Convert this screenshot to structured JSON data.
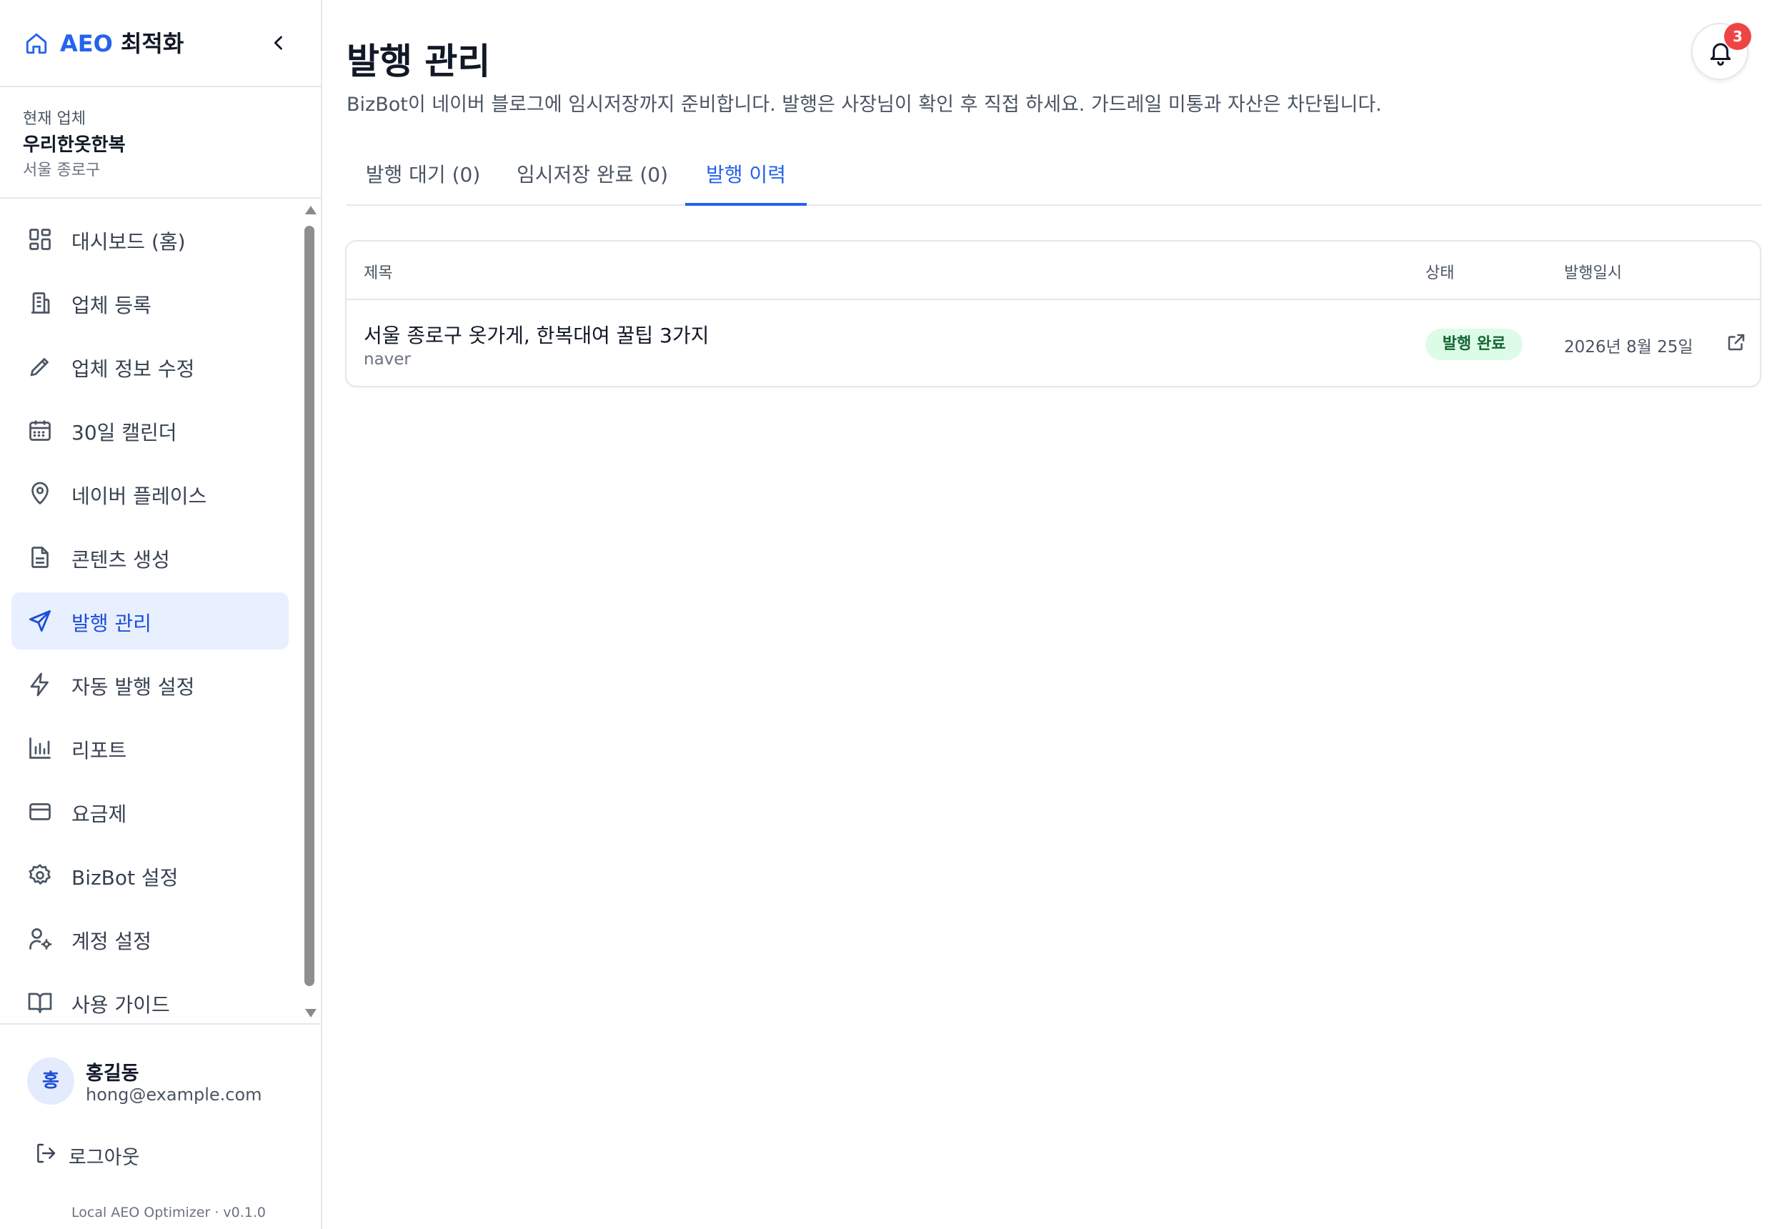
{
  "brand": {
    "accent": "AEO",
    "title": " 최적화"
  },
  "business": {
    "label": "현재 업체",
    "name": "우리한옷한복",
    "location": "서울 종로구"
  },
  "nav": {
    "items": [
      {
        "label": "대시보드 (홈)",
        "icon": "dashboard-icon"
      },
      {
        "label": "업체 등록",
        "icon": "building-icon"
      },
      {
        "label": "업체 정보 수정",
        "icon": "pencil-icon"
      },
      {
        "label": "30일 캘린더",
        "icon": "calendar-icon"
      },
      {
        "label": "네이버 플레이스",
        "icon": "map-pin-icon"
      },
      {
        "label": "콘텐츠 생성",
        "icon": "document-icon"
      },
      {
        "label": "발행 관리",
        "icon": "send-icon",
        "active": true
      },
      {
        "label": "자동 발행 설정",
        "icon": "lightning-icon"
      },
      {
        "label": "리포트",
        "icon": "bar-chart-icon"
      },
      {
        "label": "요금제",
        "icon": "credit-card-icon"
      },
      {
        "label": "BizBot 설정",
        "icon": "gear-icon"
      },
      {
        "label": "계정 설정",
        "icon": "user-cog-icon"
      },
      {
        "label": "사용 가이드",
        "icon": "book-icon"
      }
    ]
  },
  "user": {
    "initial": "홍",
    "name": "홍길동",
    "email": "hong@example.com"
  },
  "logout": {
    "label": "로그아웃"
  },
  "version": "Local AEO Optimizer · v0.1.0",
  "page": {
    "title": "발행 관리",
    "description": "BizBot이 네이버 블로그에 임시저장까지 준비합니다. 발행은 사장님이 확인 후 직접 하세요. 가드레일 미통과 자산은 차단됩니다."
  },
  "notifications": {
    "count": "3"
  },
  "tabs": [
    {
      "label": "발행 대기 (0)"
    },
    {
      "label": "임시저장 완료 (0)"
    },
    {
      "label": "발행 이력",
      "active": true
    }
  ],
  "table": {
    "headers": {
      "title": "제목",
      "status": "상태",
      "date": "발행일시"
    },
    "rows": [
      {
        "title": "서울 종로구 옷가게, 한복대여 꿀팁 3가지",
        "source": "naver",
        "status": "발행 완료",
        "date": "2026년 8월 25일"
      }
    ]
  },
  "colors": {
    "accent": "#2563eb",
    "active_bg": "#e8efff",
    "status_bg": "#dcfce7",
    "status_text": "#166534",
    "badge": "#ef4444"
  }
}
